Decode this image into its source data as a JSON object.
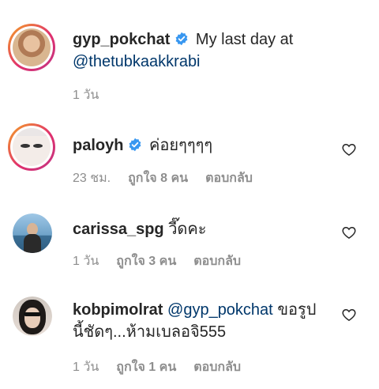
{
  "caption": {
    "username": "gyp_pokchat",
    "text": "My last day at",
    "mention": "@thetubkaakkrabi",
    "time": "1 วัน"
  },
  "comments": [
    {
      "username": "paloyh",
      "verified": true,
      "text": "ค่อยๆๆๆๆ",
      "time": "23 ชม.",
      "likes": "ถูกใจ 8 คน",
      "reply": "ตอบกลับ"
    },
    {
      "username": "carissa_spg",
      "verified": false,
      "text": "วี๊ดคะ",
      "time": "1 วัน",
      "likes": "ถูกใจ 3 คน",
      "reply": "ตอบกลับ"
    },
    {
      "username": "kobpimolrat",
      "verified": false,
      "mention": "@gyp_pokchat",
      "text_after_mention": "ขอรูป",
      "text_line2": "นี้ชัดๆ...ห้ามเบลอจิ555",
      "time": "1 วัน",
      "likes": "ถูกใจ 1 คน",
      "reply": "ตอบกลับ"
    }
  ],
  "colors": {
    "verified_blue": "#3897f0",
    "mention": "#00376b",
    "meta_gray": "#8e8e8e"
  }
}
